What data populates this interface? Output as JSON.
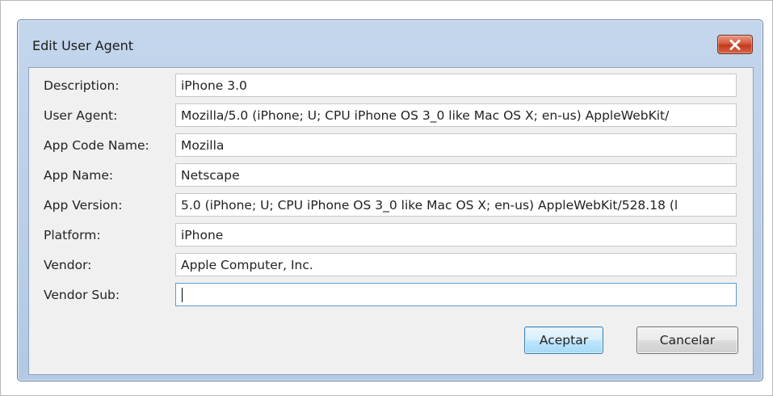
{
  "dialog": {
    "title": "Edit User Agent"
  },
  "fields": [
    {
      "label": "Description:",
      "value": "iPhone 3.0"
    },
    {
      "label": "User Agent:",
      "value": "Mozilla/5.0 (iPhone; U; CPU iPhone OS 3_0 like Mac OS X; en-us) AppleWebKit/"
    },
    {
      "label": "App Code Name:",
      "value": "Mozilla"
    },
    {
      "label": "App Name:",
      "value": "Netscape"
    },
    {
      "label": "App Version:",
      "value": "5.0 (iPhone; U; CPU iPhone OS 3_0 like Mac OS X; en-us) AppleWebKit/528.18 (l"
    },
    {
      "label": "Platform:",
      "value": "iPhone"
    },
    {
      "label": "Vendor:",
      "value": "Apple Computer, Inc."
    },
    {
      "label": "Vendor Sub:",
      "value": ""
    }
  ],
  "buttons": {
    "accept": "Aceptar",
    "cancel": "Cancelar"
  },
  "icons": {
    "close": "close-icon"
  },
  "colors": {
    "close_button": "#c2391a",
    "focus_border": "#5c9bd1",
    "frame": "#b3c9e4"
  }
}
